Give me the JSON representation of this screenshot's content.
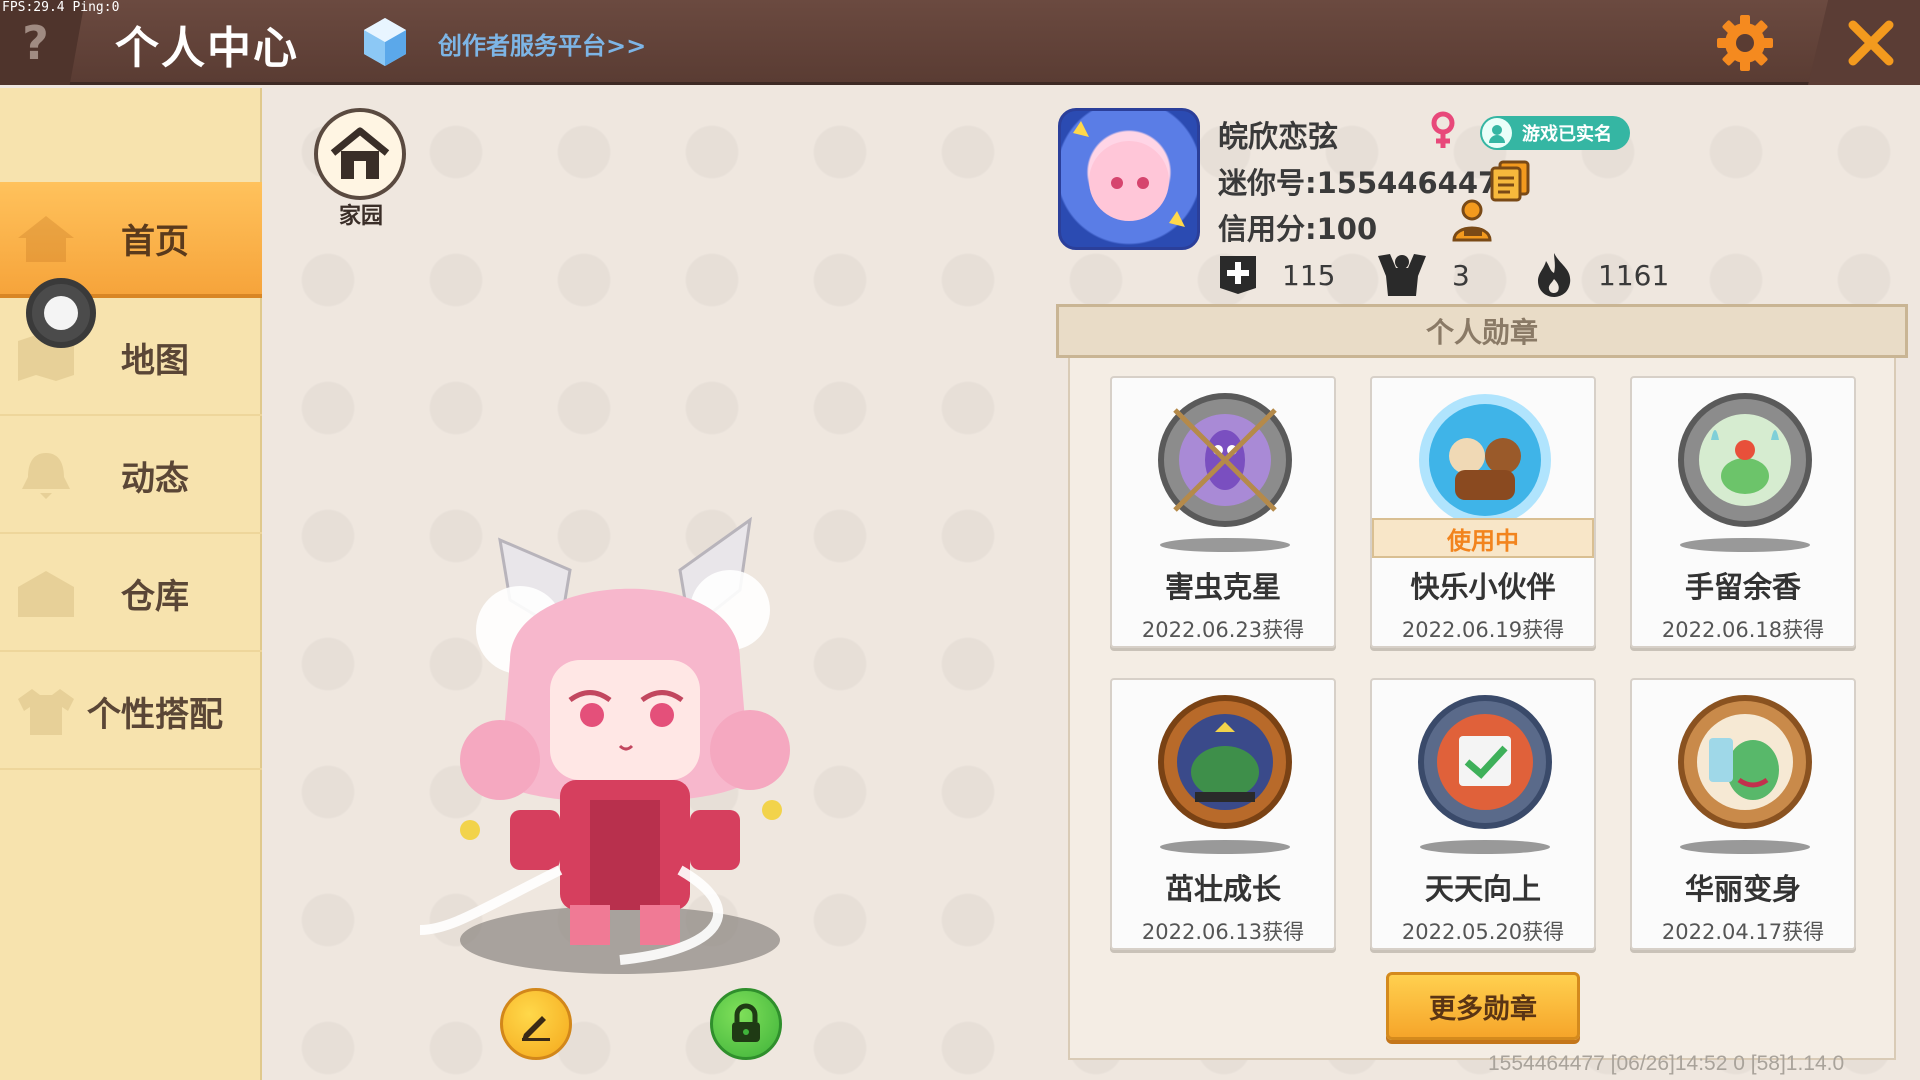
{
  "hud": {
    "fps": "FPS:29.4  Ping:0"
  },
  "header": {
    "help": "?",
    "title": "个人中心",
    "creator_link": "创作者服务平台>>"
  },
  "sidebar": {
    "items": [
      {
        "label": "首页",
        "active": true
      },
      {
        "label": "地图"
      },
      {
        "label": "动态"
      },
      {
        "label": "仓库"
      },
      {
        "label": "个性搭配"
      }
    ]
  },
  "home": {
    "label": "家园"
  },
  "profile": {
    "username": "皖欣恋弦",
    "realname_badge": "游戏已实名",
    "mini_id": "迷你号:1554464477",
    "credit": "信用分:100",
    "stats": {
      "likes": "115",
      "fans": "3",
      "popularity": "1161"
    }
  },
  "badges": {
    "header": "个人勋章",
    "in_use_label": "使用中",
    "items": [
      {
        "name": "害虫克星",
        "date": "2022.06.23获得",
        "color": "#8a6cc6"
      },
      {
        "name": "快乐小伙伴",
        "date": "2022.06.19获得",
        "color": "#3fb4e8",
        "in_use": true
      },
      {
        "name": "手留余香",
        "date": "2022.06.18获得",
        "color": "#6cc46a"
      },
      {
        "name": "茁壮成长",
        "date": "2022.06.13获得",
        "color": "#3e8f4a"
      },
      {
        "name": "天天向上",
        "date": "2022.05.20获得",
        "color": "#e0613a"
      },
      {
        "name": "华丽变身",
        "date": "2022.04.17获得",
        "color": "#58b86a"
      }
    ],
    "more_button": "更多勋章"
  },
  "footer": {
    "info": "1554464477    [06/26]14:52 0   [58]1.14.0"
  },
  "colors": {
    "topbar": "#5a3c33",
    "sidebar": "#f7e3ae",
    "active_tab": "#f6a43b",
    "accent_orange": "#f2841e",
    "close_orange": "#f39a1e"
  }
}
